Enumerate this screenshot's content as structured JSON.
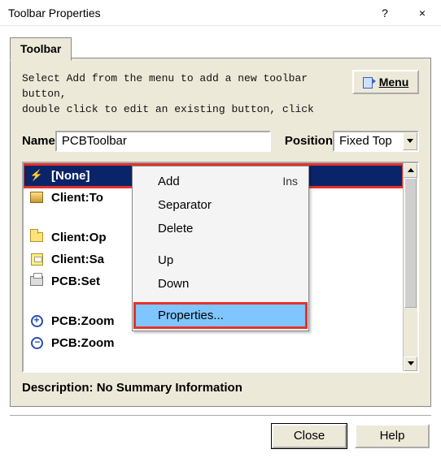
{
  "window": {
    "title": "Toolbar Properties",
    "help": "?",
    "close": "×"
  },
  "tab": {
    "label": "Toolbar"
  },
  "instructions": {
    "line1": "Select Add from the menu to add a new toolbar button,",
    "line2": "double click to edit an existing button, click"
  },
  "menu_button": {
    "label": "Menu"
  },
  "form": {
    "name_label": "Name",
    "name_value": "PCBToolbar",
    "position_label": "Position",
    "position_value": "Fixed Top"
  },
  "list": {
    "items": [
      {
        "icon": "bolt-icon",
        "label": "[None]",
        "selected": true
      },
      {
        "icon": "tool-icon",
        "label": "Client:To"
      },
      {
        "icon": "open-icon",
        "label": "Client:Op"
      },
      {
        "icon": "save-icon",
        "label": "Client:Sa"
      },
      {
        "icon": "print-icon",
        "label": "PCB:Set"
      },
      {
        "icon": "zoom-in-icon",
        "label": "PCB:Zoom"
      },
      {
        "icon": "zoom-out-icon",
        "label": "PCB:Zoom"
      }
    ]
  },
  "context_menu": {
    "items": [
      {
        "label": "Add",
        "shortcut": "Ins"
      },
      {
        "label": "Separator"
      },
      {
        "label": "Delete"
      }
    ],
    "items2": [
      {
        "label": "Up"
      },
      {
        "label": "Down"
      }
    ],
    "items3": [
      {
        "label": "Properties...",
        "highlight": true
      }
    ]
  },
  "description": {
    "label": "Description:",
    "value": "No Summary Information"
  },
  "buttons": {
    "close": "Close",
    "help": "Help"
  }
}
